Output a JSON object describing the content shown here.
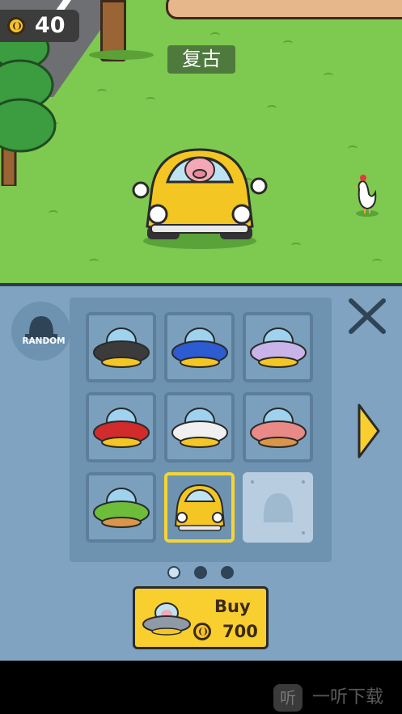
{
  "hud": {
    "coins": "40",
    "coin_icon": "coin-icon"
  },
  "scene": {
    "vehicle_name": "复古",
    "player_vehicle": "yellow-retro-car-with-pig",
    "npc": "chicken"
  },
  "garage": {
    "random_label": "RANDOM",
    "vehicles": [
      {
        "name": "black-ufo",
        "color": "#3b3b3b"
      },
      {
        "name": "blue-ufo",
        "color": "#2d5bd1"
      },
      {
        "name": "purple-ufo",
        "color": "#c8b4e8"
      },
      {
        "name": "red-ufo",
        "color": "#d12b2b"
      },
      {
        "name": "white-ufo",
        "color": "#f0f0f0"
      },
      {
        "name": "donut-ufo",
        "color": "#e98a86"
      },
      {
        "name": "green-ufo",
        "color": "#6dbd3a"
      },
      {
        "name": "yellow-car",
        "color": "#f4c623"
      },
      {
        "name": "locked-slot",
        "color": "#b9cde0"
      }
    ],
    "selected_index": 7,
    "page_dots": 3,
    "active_page": 0
  },
  "buy": {
    "label": "Buy",
    "price": "700"
  },
  "watermark": {
    "icon_glyph": "听",
    "text": "一听下载"
  },
  "colors": {
    "grass": "#7ec94f",
    "panel": "#7fa3c0",
    "accent": "#f8cf2f",
    "selected_border": "#f4d534"
  }
}
